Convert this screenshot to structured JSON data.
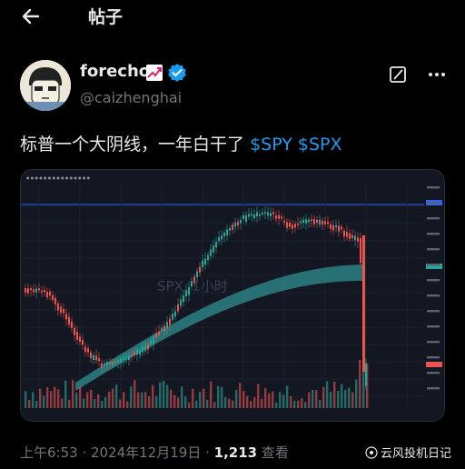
{
  "header": {
    "title": "帖子"
  },
  "author": {
    "name": "forecho",
    "handle": "@caizhenghai"
  },
  "post": {
    "text": "标普一个大阴线，一年白干了",
    "cashtags": [
      "$SPY",
      "$SPX"
    ]
  },
  "chart_overlay": {
    "symbol": "SPX, 1小时"
  },
  "meta": {
    "time": "上午6:53",
    "sep1": " · ",
    "date": "2024年12月19日",
    "sep2": " · ",
    "views": "1,213",
    "views_label": " 查看"
  },
  "watermark": {
    "text": "云风投机日记"
  },
  "colors": {
    "accent": "#1d9bf0",
    "up": "#26a69a",
    "down": "#ef5350",
    "cloud": "#2f8f8f"
  },
  "icons": [
    "back-arrow-icon",
    "trend-icon",
    "verified-icon",
    "grok-icon",
    "more-icon"
  ]
}
